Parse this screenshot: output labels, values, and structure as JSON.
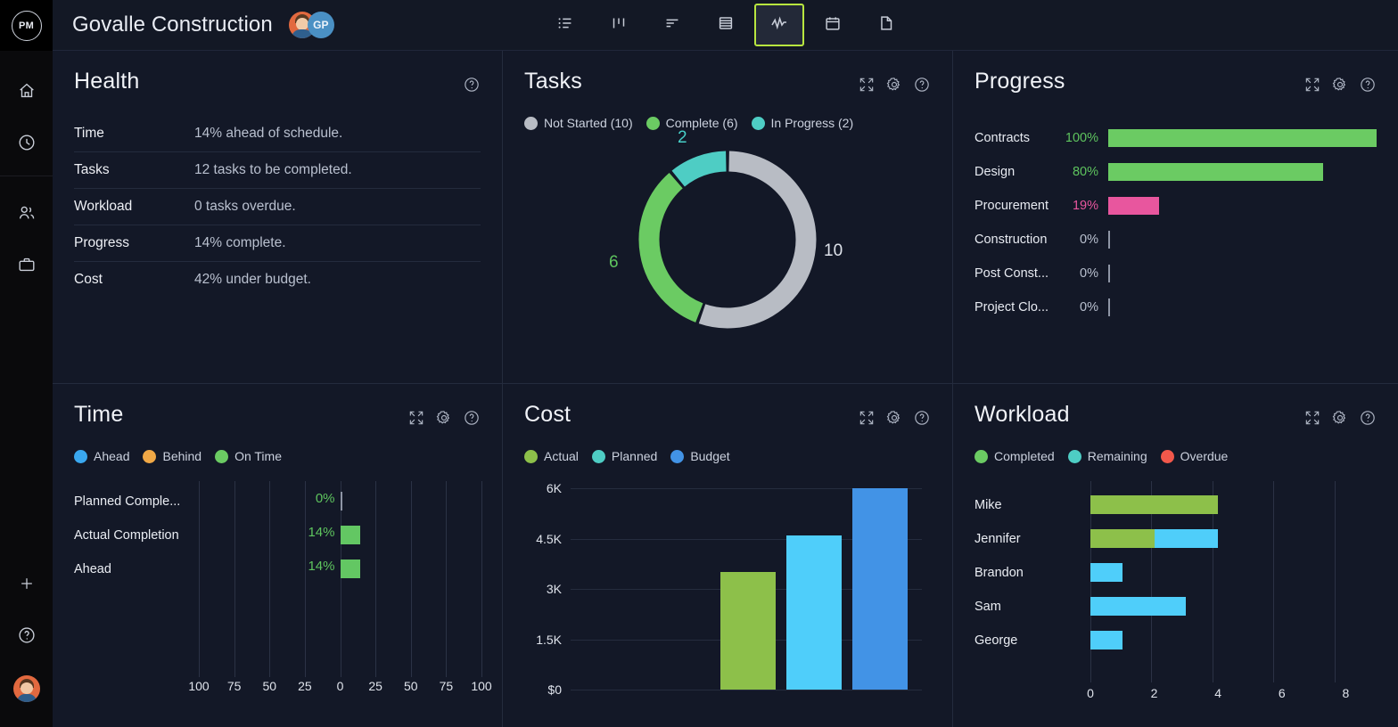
{
  "colors": {
    "green": "#6BCB63",
    "bar_green": "#63c763",
    "olive": "#8DC04A",
    "teal": "#4ECDC4",
    "cyan": "#4FCEFA",
    "blue": "#4293E6",
    "gray": "#B8BCC4",
    "pink": "#E8569E",
    "orange": "#F0A846",
    "red": "#F2584B",
    "accent_tab": "#b8e63f"
  },
  "rail": {
    "logo_label": "PM",
    "items": [
      {
        "name": "home-icon",
        "label": "Home"
      },
      {
        "name": "clock-icon",
        "label": "Recent"
      },
      {
        "name": "people-icon",
        "label": "People"
      },
      {
        "name": "briefcase-icon",
        "label": "Projects"
      }
    ],
    "bottom": [
      {
        "name": "plus-icon",
        "label": "Add"
      },
      {
        "name": "help-circle-icon",
        "label": "Help"
      }
    ]
  },
  "header": {
    "project_title": "Govalle Construction",
    "avatars": [
      {
        "name": "avatar-user-photo",
        "label": ""
      },
      {
        "name": "avatar-initials",
        "label": "GP"
      }
    ],
    "view_tabs": [
      {
        "name": "tab-list",
        "icon": "list-icon",
        "label": "List",
        "active": false
      },
      {
        "name": "tab-board",
        "icon": "board-icon",
        "label": "Board",
        "active": false
      },
      {
        "name": "tab-gantt",
        "icon": "gantt-icon",
        "label": "Gantt",
        "active": false
      },
      {
        "name": "tab-sheet",
        "icon": "sheet-icon",
        "label": "Sheet",
        "active": false
      },
      {
        "name": "tab-dashboard",
        "icon": "pulse-icon",
        "label": "Dashboard",
        "active": true
      },
      {
        "name": "tab-calendar",
        "icon": "calendar-icon",
        "label": "Calendar",
        "active": false
      },
      {
        "name": "tab-files",
        "icon": "file-icon",
        "label": "Files",
        "active": false
      }
    ]
  },
  "panels": {
    "health": {
      "title": "Health",
      "tools": [
        "help-circle-icon"
      ],
      "rows": [
        {
          "key": "Time",
          "value": "14% ahead of schedule."
        },
        {
          "key": "Tasks",
          "value": "12 tasks to be completed."
        },
        {
          "key": "Workload",
          "value": "0 tasks overdue."
        },
        {
          "key": "Progress",
          "value": "14% complete."
        },
        {
          "key": "Cost",
          "value": "42% under budget."
        }
      ]
    },
    "tasks": {
      "title": "Tasks",
      "tools": [
        "expand-icon",
        "gear-icon",
        "help-circle-icon"
      ]
    },
    "progress": {
      "title": "Progress",
      "tools": [
        "expand-icon",
        "gear-icon",
        "help-circle-icon"
      ]
    },
    "time": {
      "title": "Time",
      "tools": [
        "expand-icon",
        "gear-icon",
        "help-circle-icon"
      ]
    },
    "cost": {
      "title": "Cost",
      "tools": [
        "expand-icon",
        "gear-icon",
        "help-circle-icon"
      ]
    },
    "workload": {
      "title": "Workload",
      "tools": [
        "expand-icon",
        "gear-icon",
        "help-circle-icon"
      ]
    }
  },
  "chart_data": [
    {
      "id": "tasks_donut",
      "type": "pie",
      "title": "Tasks",
      "legend_position": "top",
      "categories": [
        "Not Started",
        "Complete",
        "In Progress"
      ],
      "values": [
        10,
        6,
        2
      ],
      "total": 18,
      "legend": [
        {
          "label": "Not Started (10)",
          "color": "#B8BCC4",
          "value": 10
        },
        {
          "label": "Complete (6)",
          "color": "#6BCB63",
          "value": 6
        },
        {
          "label": "In Progress (2)",
          "color": "#4ECDC4",
          "value": 2
        }
      ],
      "slice_labels": [
        {
          "text": "10",
          "color": "#dfe3eb"
        },
        {
          "text": "6",
          "color": "#5ec45e"
        },
        {
          "text": "2",
          "color": "#47cfc8"
        }
      ]
    },
    {
      "id": "progress_bars",
      "type": "bar",
      "title": "Progress",
      "orientation": "horizontal",
      "xlabel": "",
      "ylabel": "",
      "xlim": [
        0,
        100
      ],
      "grid": false,
      "categories": [
        "Contracts",
        "Design",
        "Procurement",
        "Construction",
        "Post Const...",
        "Project Clo..."
      ],
      "values": [
        100,
        80,
        19,
        0,
        0,
        0
      ],
      "value_labels": [
        "100%",
        "80%",
        "19%",
        "0%",
        "0%",
        "0%"
      ],
      "bar_colors": [
        "#6BCB63",
        "#6BCB63",
        "#E8569E",
        "#8e95a5",
        "#8e95a5",
        "#8e95a5"
      ],
      "label_colors": [
        "#5ec45e",
        "#5ec45e",
        "#E8569E",
        "#b9c0cf",
        "#b9c0cf",
        "#b9c0cf"
      ]
    },
    {
      "id": "time_bars",
      "type": "bar",
      "title": "Time",
      "orientation": "horizontal",
      "axis_type": "diverging",
      "grid": true,
      "ticks": [
        "100",
        "75",
        "50",
        "25",
        "0",
        "25",
        "50",
        "75",
        "100"
      ],
      "legend": [
        {
          "label": "Ahead",
          "color": "#3AA8F0"
        },
        {
          "label": "Behind",
          "color": "#F0A846"
        },
        {
          "label": "On Time",
          "color": "#6BCB63"
        }
      ],
      "categories": [
        "Planned Comple...",
        "Actual Completion",
        "Ahead"
      ],
      "values": [
        0,
        14,
        14
      ],
      "value_labels": [
        "0%",
        "14%",
        "14%"
      ],
      "bar_color": "#63c763"
    },
    {
      "id": "cost_bars",
      "type": "bar",
      "title": "Cost",
      "orientation": "vertical",
      "grid": true,
      "ylim": [
        0,
        6000
      ],
      "yticks": [
        "$0",
        "1.5K",
        "3K",
        "4.5K",
        "6K"
      ],
      "ytick_values": [
        0,
        1500,
        3000,
        4500,
        6000
      ],
      "legend": [
        {
          "label": "Actual",
          "color": "#8DC04A"
        },
        {
          "label": "Planned",
          "color": "#4ECDC4"
        },
        {
          "label": "Budget",
          "color": "#4293E6"
        }
      ],
      "categories": [
        "Actual",
        "Planned",
        "Budget"
      ],
      "values": [
        3500,
        4600,
        6000
      ],
      "bar_colors": [
        "#8DC04A",
        "#4FCEFA",
        "#4293E6"
      ]
    },
    {
      "id": "workload_bars",
      "type": "bar",
      "title": "Workload",
      "orientation": "horizontal",
      "stacked": true,
      "grid": true,
      "xlim": [
        0,
        8.8
      ],
      "xticks": [
        "0",
        "2",
        "4",
        "6",
        "8"
      ],
      "xtick_values": [
        0,
        2,
        4,
        6,
        8
      ],
      "legend": [
        {
          "label": "Completed",
          "color": "#6BCB63"
        },
        {
          "label": "Remaining",
          "color": "#4ECDC4"
        },
        {
          "label": "Overdue",
          "color": "#F2584B"
        }
      ],
      "categories": [
        "Mike",
        "Jennifer",
        "Brandon",
        "Sam",
        "George"
      ],
      "series": [
        {
          "name": "Completed",
          "color": "#8DC04A",
          "values": [
            4,
            2,
            0,
            0,
            0
          ]
        },
        {
          "name": "Remaining",
          "color": "#4FCEFA",
          "values": [
            0,
            2,
            1,
            3,
            1
          ]
        },
        {
          "name": "Overdue",
          "color": "#F2584B",
          "values": [
            0,
            0,
            0,
            0,
            0
          ]
        }
      ]
    }
  ]
}
